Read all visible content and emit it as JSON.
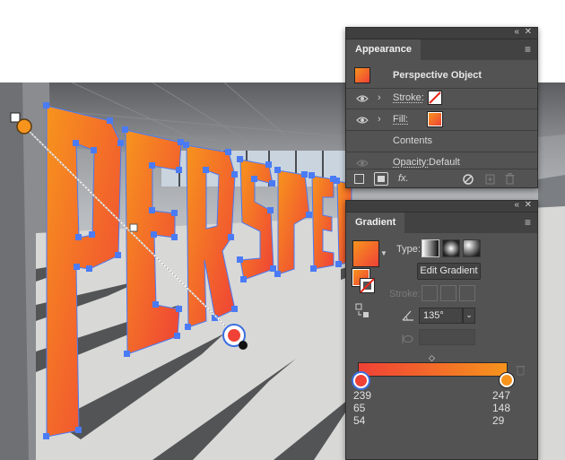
{
  "appearance": {
    "tab_title": "Appearance",
    "collapse_glyph": "«",
    "close_glyph": "✕",
    "menu_glyph": "≡",
    "object_label": "Perspective Object",
    "stroke_label": "Stroke:",
    "fill_label": "Fill:",
    "contents_label": "Contents",
    "opacity_label": "Opacity:",
    "opacity_value": "Default",
    "fx_label": "fx."
  },
  "gradient": {
    "tab_title": "Gradient",
    "collapse_glyph": "«",
    "close_glyph": "✕",
    "menu_glyph": "≡",
    "type_label": "Type:",
    "edit_button": "Edit Gradient",
    "stroke_label": "Stroke:",
    "angle_value": "135°",
    "stops": [
      {
        "r": "239",
        "g": "65",
        "b": "54",
        "color": "#ef4136"
      },
      {
        "r": "247",
        "g": "148",
        "b": "29",
        "color": "#f7941d"
      }
    ]
  },
  "canvas": {
    "artwork_text": "PERSPECTIVE",
    "gradient_start": "#f7941d",
    "gradient_end": "#ef4136",
    "selection_color": "#4a7bf5"
  }
}
